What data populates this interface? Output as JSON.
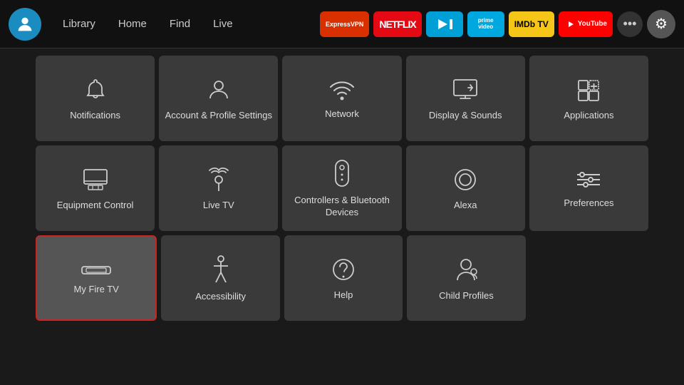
{
  "topbar": {
    "nav": [
      {
        "label": "Library",
        "name": "library"
      },
      {
        "label": "Home",
        "name": "home"
      },
      {
        "label": "Find",
        "name": "find"
      },
      {
        "label": "Live",
        "name": "live"
      }
    ],
    "apps": [
      {
        "label": "ExpressVPN",
        "name": "expressvpn",
        "class": "badge-expressvpn"
      },
      {
        "label": "NETFLIX",
        "name": "netflix",
        "class": "badge-netflix"
      },
      {
        "label": "▶",
        "name": "freevee",
        "class": "badge-freeveee"
      },
      {
        "label": "prime video",
        "name": "prime",
        "class": "badge-prime"
      },
      {
        "label": "IMDb TV",
        "name": "imdb",
        "class": "badge-imdb"
      },
      {
        "label": "▶ YouTube",
        "name": "youtube",
        "class": "badge-youtube"
      }
    ],
    "more_label": "•••",
    "settings_icon": "⚙"
  },
  "grid": {
    "rows": [
      [
        {
          "id": "notifications",
          "label": "Notifications",
          "icon": "bell"
        },
        {
          "id": "account-profile",
          "label": "Account & Profile Settings",
          "icon": "person"
        },
        {
          "id": "network",
          "label": "Network",
          "icon": "wifi"
        },
        {
          "id": "display-sounds",
          "label": "Display & Sounds",
          "icon": "display"
        },
        {
          "id": "applications",
          "label": "Applications",
          "icon": "apps"
        }
      ],
      [
        {
          "id": "equipment-control",
          "label": "Equipment Control",
          "icon": "monitor"
        },
        {
          "id": "live-tv",
          "label": "Live TV",
          "icon": "antenna"
        },
        {
          "id": "controllers-bluetooth",
          "label": "Controllers & Bluetooth Devices",
          "icon": "remote"
        },
        {
          "id": "alexa",
          "label": "Alexa",
          "icon": "alexa"
        },
        {
          "id": "preferences",
          "label": "Preferences",
          "icon": "sliders"
        }
      ],
      [
        {
          "id": "my-fire-tv",
          "label": "My Fire TV",
          "icon": "firestick",
          "selected": true
        },
        {
          "id": "accessibility",
          "label": "Accessibility",
          "icon": "accessibility"
        },
        {
          "id": "help",
          "label": "Help",
          "icon": "help"
        },
        {
          "id": "child-profiles",
          "label": "Child Profiles",
          "icon": "child"
        },
        {
          "id": "empty",
          "label": "",
          "icon": "none"
        }
      ]
    ]
  }
}
